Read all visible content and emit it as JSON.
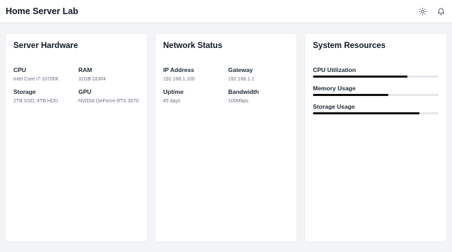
{
  "header": {
    "title": "Home Server Lab",
    "icons": [
      "sun-icon",
      "bell-icon"
    ]
  },
  "hardware": {
    "title": "Server Hardware",
    "fields": [
      {
        "label": "CPU",
        "value": "Intel Core i7-10700K"
      },
      {
        "label": "RAM",
        "value": "32GB DDR4"
      },
      {
        "label": "Storage",
        "value": "2TB SSD, 4TB HDD"
      },
      {
        "label": "GPU",
        "value": "NVIDIA GeForce RTX 3070"
      }
    ]
  },
  "network": {
    "title": "Network Status",
    "fields": [
      {
        "label": "IP Address",
        "value": "192.168.1.100"
      },
      {
        "label": "Gateway",
        "value": "192.168.1.1"
      },
      {
        "label": "Uptime",
        "value": "45 days"
      },
      {
        "label": "Bandwidth",
        "value": "100Mbps"
      }
    ]
  },
  "resources": {
    "title": "System Resources",
    "items": [
      {
        "label": "CPU Utilization",
        "percent": 75
      },
      {
        "label": "Memory Usage",
        "percent": 60
      },
      {
        "label": "Storage Usage",
        "percent": 85
      }
    ]
  },
  "colors": {
    "bar_fill": "#111111",
    "bar_track": "#e5e7eb",
    "background": "#f3f4f6"
  }
}
